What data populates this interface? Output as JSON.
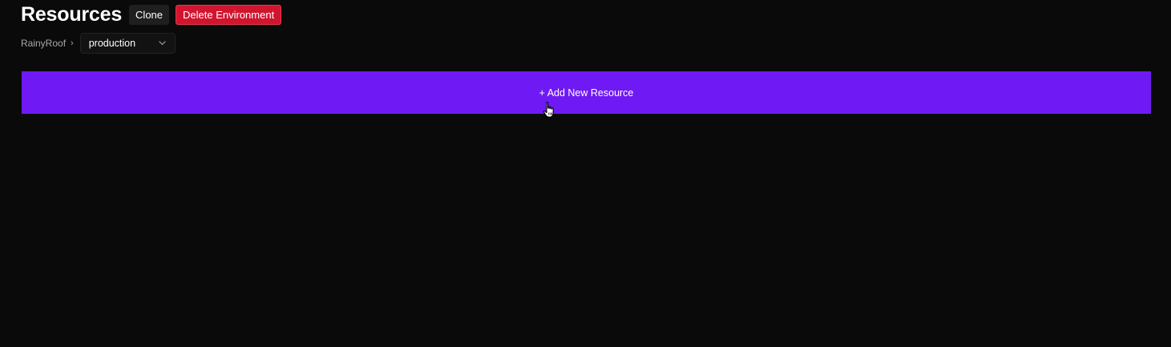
{
  "header": {
    "title": "Resources",
    "clone_label": "Clone",
    "delete_label": "Delete Environment"
  },
  "breadcrumb": {
    "project": "RainyRoof",
    "separator": "›",
    "environment": "production"
  },
  "main": {
    "add_resource_label": "+ Add New Resource"
  },
  "colors": {
    "background": "#0a0a0a",
    "accent": "#6f1af4",
    "danger": "#d1152f"
  },
  "icons": {
    "env_dropdown": "chevron-down-icon",
    "pointer": "hand-pointer-cursor-icon"
  }
}
